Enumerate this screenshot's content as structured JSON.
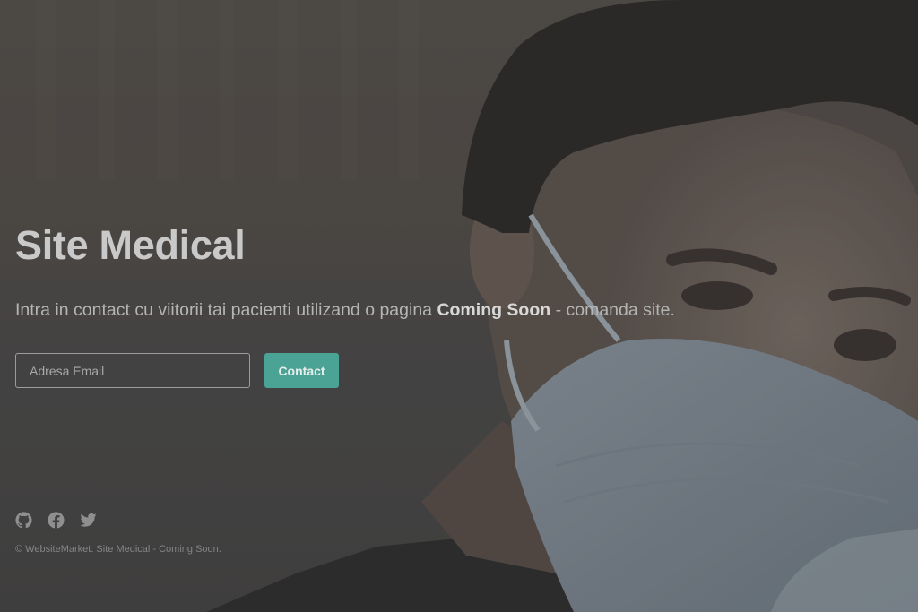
{
  "hero": {
    "title": "Site Medical",
    "subtitle_before": "Intra in contact cu viitorii tai pacienti utilizand o pagina ",
    "subtitle_bold": "Coming Soon",
    "subtitle_after": " - comanda site."
  },
  "form": {
    "email_placeholder": "Adresa Email",
    "email_value": "",
    "contact_label": "Contact"
  },
  "socials": [
    {
      "icon": "github-icon"
    },
    {
      "icon": "facebook-icon"
    },
    {
      "icon": "twitter-icon"
    }
  ],
  "footer": {
    "copyright": "© WebsiteMarket. Site Medical - Coming Soon."
  },
  "colors": {
    "accent": "#4aa394",
    "background_overlay": "#4a4847"
  }
}
